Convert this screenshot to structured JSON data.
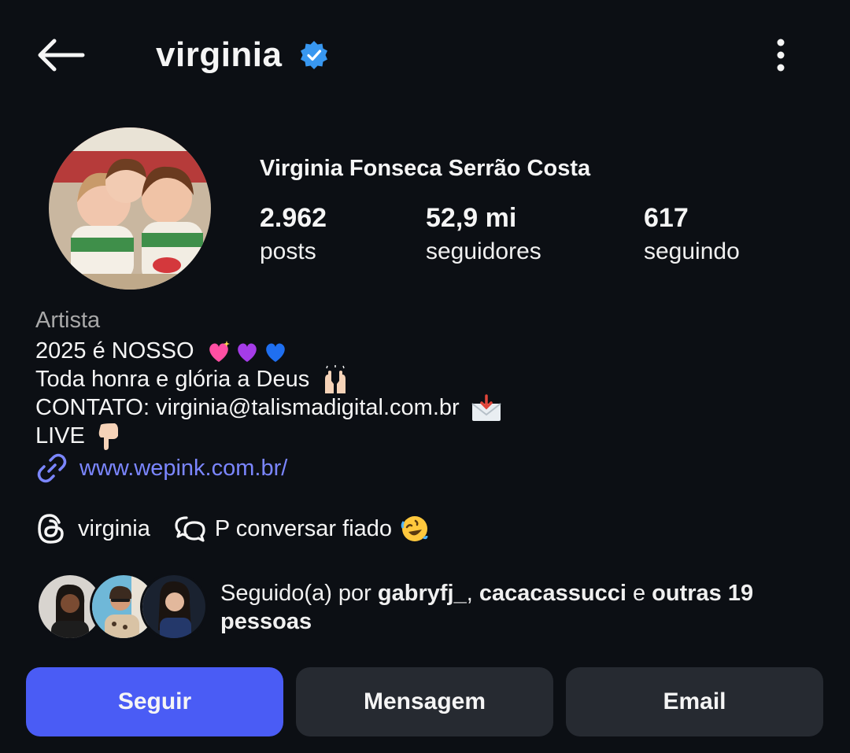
{
  "header": {
    "username": "virginia",
    "icons": {
      "back": "arrow-left-icon",
      "verified": "verified-badge-icon",
      "more": "more-vertical-icon"
    }
  },
  "profile": {
    "full_name": "Virginia Fonseca Serrão Costa",
    "stats": {
      "posts": {
        "value": "2.962",
        "label": "posts"
      },
      "followers": {
        "value": "52,9 mi",
        "label": "seguidores"
      },
      "following": {
        "value": "617",
        "label": "seguindo"
      }
    }
  },
  "bio": {
    "category": "Artista",
    "line1": "2025 é NOSSO",
    "line2": "Toda honra e glória a Deus",
    "line3": "CONTATO: virginia@talismadigital.com.br",
    "line4": "LIVE",
    "link": "www.wepink.com.br/"
  },
  "threads": {
    "handle": "virginia",
    "chat_label": "P conversar fiado"
  },
  "followed_by": {
    "prefix": "Seguido(a) por ",
    "user1": "gabryfj_",
    "separator": ", ",
    "user2": "cacacassucci",
    "joiner": " e ",
    "others": "outras 19 pessoas"
  },
  "actions": {
    "follow": "Seguir",
    "message": "Mensagem",
    "email": "Email"
  },
  "colors": {
    "background": "#0c0f14",
    "accent": "#4a5cf5",
    "link": "#7b86ff",
    "verified": "#3897f0",
    "secondary_button": "#262a31"
  }
}
